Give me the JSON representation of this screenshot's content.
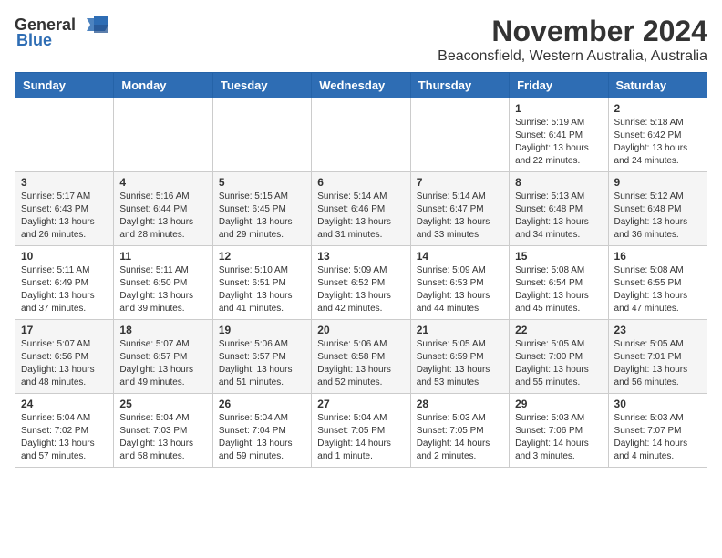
{
  "logo": {
    "general": "General",
    "blue": "Blue"
  },
  "title": "November 2024",
  "subtitle": "Beaconsfield, Western Australia, Australia",
  "days_of_week": [
    "Sunday",
    "Monday",
    "Tuesday",
    "Wednesday",
    "Thursday",
    "Friday",
    "Saturday"
  ],
  "weeks": [
    [
      {
        "day": "",
        "info": ""
      },
      {
        "day": "",
        "info": ""
      },
      {
        "day": "",
        "info": ""
      },
      {
        "day": "",
        "info": ""
      },
      {
        "day": "",
        "info": ""
      },
      {
        "day": "1",
        "info": "Sunrise: 5:19 AM\nSunset: 6:41 PM\nDaylight: 13 hours\nand 22 minutes."
      },
      {
        "day": "2",
        "info": "Sunrise: 5:18 AM\nSunset: 6:42 PM\nDaylight: 13 hours\nand 24 minutes."
      }
    ],
    [
      {
        "day": "3",
        "info": "Sunrise: 5:17 AM\nSunset: 6:43 PM\nDaylight: 13 hours\nand 26 minutes."
      },
      {
        "day": "4",
        "info": "Sunrise: 5:16 AM\nSunset: 6:44 PM\nDaylight: 13 hours\nand 28 minutes."
      },
      {
        "day": "5",
        "info": "Sunrise: 5:15 AM\nSunset: 6:45 PM\nDaylight: 13 hours\nand 29 minutes."
      },
      {
        "day": "6",
        "info": "Sunrise: 5:14 AM\nSunset: 6:46 PM\nDaylight: 13 hours\nand 31 minutes."
      },
      {
        "day": "7",
        "info": "Sunrise: 5:14 AM\nSunset: 6:47 PM\nDaylight: 13 hours\nand 33 minutes."
      },
      {
        "day": "8",
        "info": "Sunrise: 5:13 AM\nSunset: 6:48 PM\nDaylight: 13 hours\nand 34 minutes."
      },
      {
        "day": "9",
        "info": "Sunrise: 5:12 AM\nSunset: 6:48 PM\nDaylight: 13 hours\nand 36 minutes."
      }
    ],
    [
      {
        "day": "10",
        "info": "Sunrise: 5:11 AM\nSunset: 6:49 PM\nDaylight: 13 hours\nand 37 minutes."
      },
      {
        "day": "11",
        "info": "Sunrise: 5:11 AM\nSunset: 6:50 PM\nDaylight: 13 hours\nand 39 minutes."
      },
      {
        "day": "12",
        "info": "Sunrise: 5:10 AM\nSunset: 6:51 PM\nDaylight: 13 hours\nand 41 minutes."
      },
      {
        "day": "13",
        "info": "Sunrise: 5:09 AM\nSunset: 6:52 PM\nDaylight: 13 hours\nand 42 minutes."
      },
      {
        "day": "14",
        "info": "Sunrise: 5:09 AM\nSunset: 6:53 PM\nDaylight: 13 hours\nand 44 minutes."
      },
      {
        "day": "15",
        "info": "Sunrise: 5:08 AM\nSunset: 6:54 PM\nDaylight: 13 hours\nand 45 minutes."
      },
      {
        "day": "16",
        "info": "Sunrise: 5:08 AM\nSunset: 6:55 PM\nDaylight: 13 hours\nand 47 minutes."
      }
    ],
    [
      {
        "day": "17",
        "info": "Sunrise: 5:07 AM\nSunset: 6:56 PM\nDaylight: 13 hours\nand 48 minutes."
      },
      {
        "day": "18",
        "info": "Sunrise: 5:07 AM\nSunset: 6:57 PM\nDaylight: 13 hours\nand 49 minutes."
      },
      {
        "day": "19",
        "info": "Sunrise: 5:06 AM\nSunset: 6:57 PM\nDaylight: 13 hours\nand 51 minutes."
      },
      {
        "day": "20",
        "info": "Sunrise: 5:06 AM\nSunset: 6:58 PM\nDaylight: 13 hours\nand 52 minutes."
      },
      {
        "day": "21",
        "info": "Sunrise: 5:05 AM\nSunset: 6:59 PM\nDaylight: 13 hours\nand 53 minutes."
      },
      {
        "day": "22",
        "info": "Sunrise: 5:05 AM\nSunset: 7:00 PM\nDaylight: 13 hours\nand 55 minutes."
      },
      {
        "day": "23",
        "info": "Sunrise: 5:05 AM\nSunset: 7:01 PM\nDaylight: 13 hours\nand 56 minutes."
      }
    ],
    [
      {
        "day": "24",
        "info": "Sunrise: 5:04 AM\nSunset: 7:02 PM\nDaylight: 13 hours\nand 57 minutes."
      },
      {
        "day": "25",
        "info": "Sunrise: 5:04 AM\nSunset: 7:03 PM\nDaylight: 13 hours\nand 58 minutes."
      },
      {
        "day": "26",
        "info": "Sunrise: 5:04 AM\nSunset: 7:04 PM\nDaylight: 13 hours\nand 59 minutes."
      },
      {
        "day": "27",
        "info": "Sunrise: 5:04 AM\nSunset: 7:05 PM\nDaylight: 14 hours\nand 1 minute."
      },
      {
        "day": "28",
        "info": "Sunrise: 5:03 AM\nSunset: 7:05 PM\nDaylight: 14 hours\nand 2 minutes."
      },
      {
        "day": "29",
        "info": "Sunrise: 5:03 AM\nSunset: 7:06 PM\nDaylight: 14 hours\nand 3 minutes."
      },
      {
        "day": "30",
        "info": "Sunrise: 5:03 AM\nSunset: 7:07 PM\nDaylight: 14 hours\nand 4 minutes."
      }
    ]
  ]
}
